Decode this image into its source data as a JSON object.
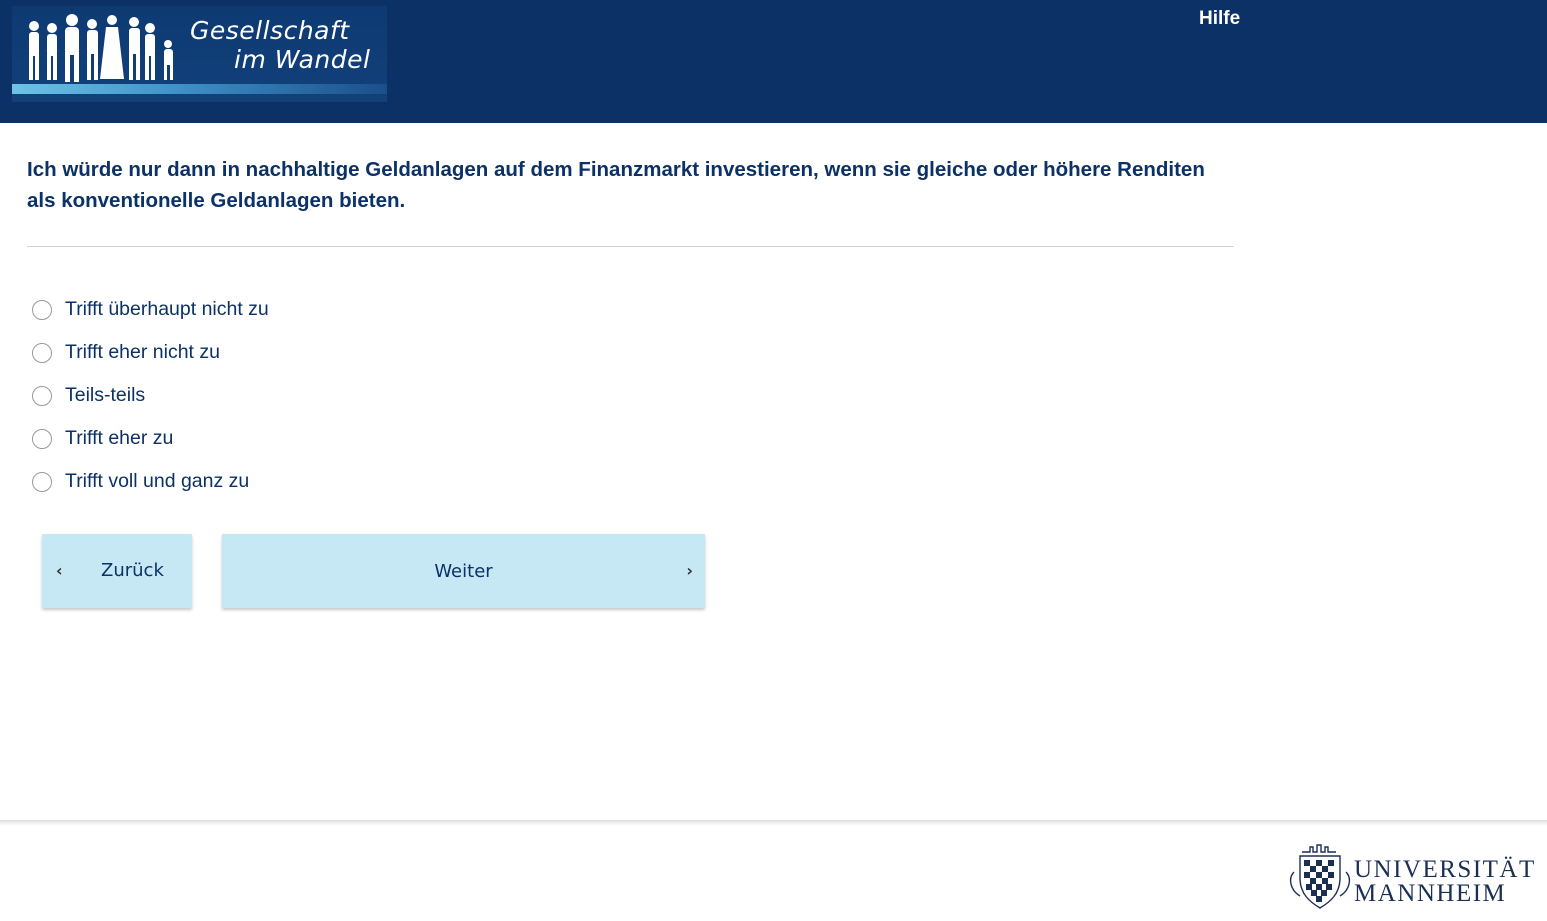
{
  "header": {
    "logo_line1": "Gesellschaft",
    "logo_line2": "im Wandel",
    "help_label": "Hilfe",
    "background_color": "#0b3166"
  },
  "question": {
    "text": "Ich würde nur dann in nachhaltige Geldanlagen auf dem Finanzmarkt investieren, wenn sie gleiche oder höhere Renditen als konventionelle Geldanlagen bieten."
  },
  "options": [
    {
      "label": "Trifft überhaupt nicht zu",
      "selected": false
    },
    {
      "label": "Trifft eher nicht zu",
      "selected": false
    },
    {
      "label": "Teils-teils",
      "selected": false
    },
    {
      "label": "Trifft eher zu",
      "selected": false
    },
    {
      "label": "Trifft voll und ganz zu",
      "selected": false
    }
  ],
  "navigation": {
    "back_label": "Zurück",
    "next_label": "Weiter",
    "button_color": "#c6e8f5"
  },
  "footer": {
    "university_line1": "UNIVERSITÄT",
    "university_line2": "MANNHEIM"
  },
  "icons": {
    "back": "chevron-left-icon",
    "next": "chevron-right-icon"
  }
}
